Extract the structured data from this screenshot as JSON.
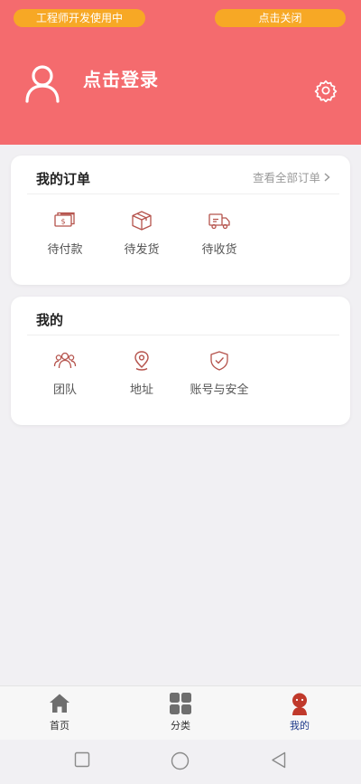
{
  "header": {
    "dev_badge": "工程师开发使用中",
    "close_badge": "点击关闭",
    "login_label": "点击登录",
    "bg_color": "#f46b6e",
    "badge_color": "#f7a825"
  },
  "orders": {
    "title": "我的订单",
    "view_all": "查看全部订单",
    "items": [
      {
        "label": "待付款",
        "icon": "wallet-icon"
      },
      {
        "label": "待发货",
        "icon": "package-icon"
      },
      {
        "label": "待收货",
        "icon": "truck-icon"
      }
    ]
  },
  "mine": {
    "title": "我的",
    "items": [
      {
        "label": "团队",
        "icon": "team-icon"
      },
      {
        "label": "地址",
        "icon": "location-icon"
      },
      {
        "label": "账号与安全",
        "icon": "shield-icon"
      }
    ]
  },
  "tabbar": {
    "items": [
      {
        "label": "首页",
        "icon": "home-icon"
      },
      {
        "label": "分类",
        "icon": "grid-icon"
      },
      {
        "label": "我的",
        "icon": "user-icon",
        "active": true
      }
    ],
    "active_color": "#1e3a8a",
    "active_icon_color": "#c0392b"
  }
}
